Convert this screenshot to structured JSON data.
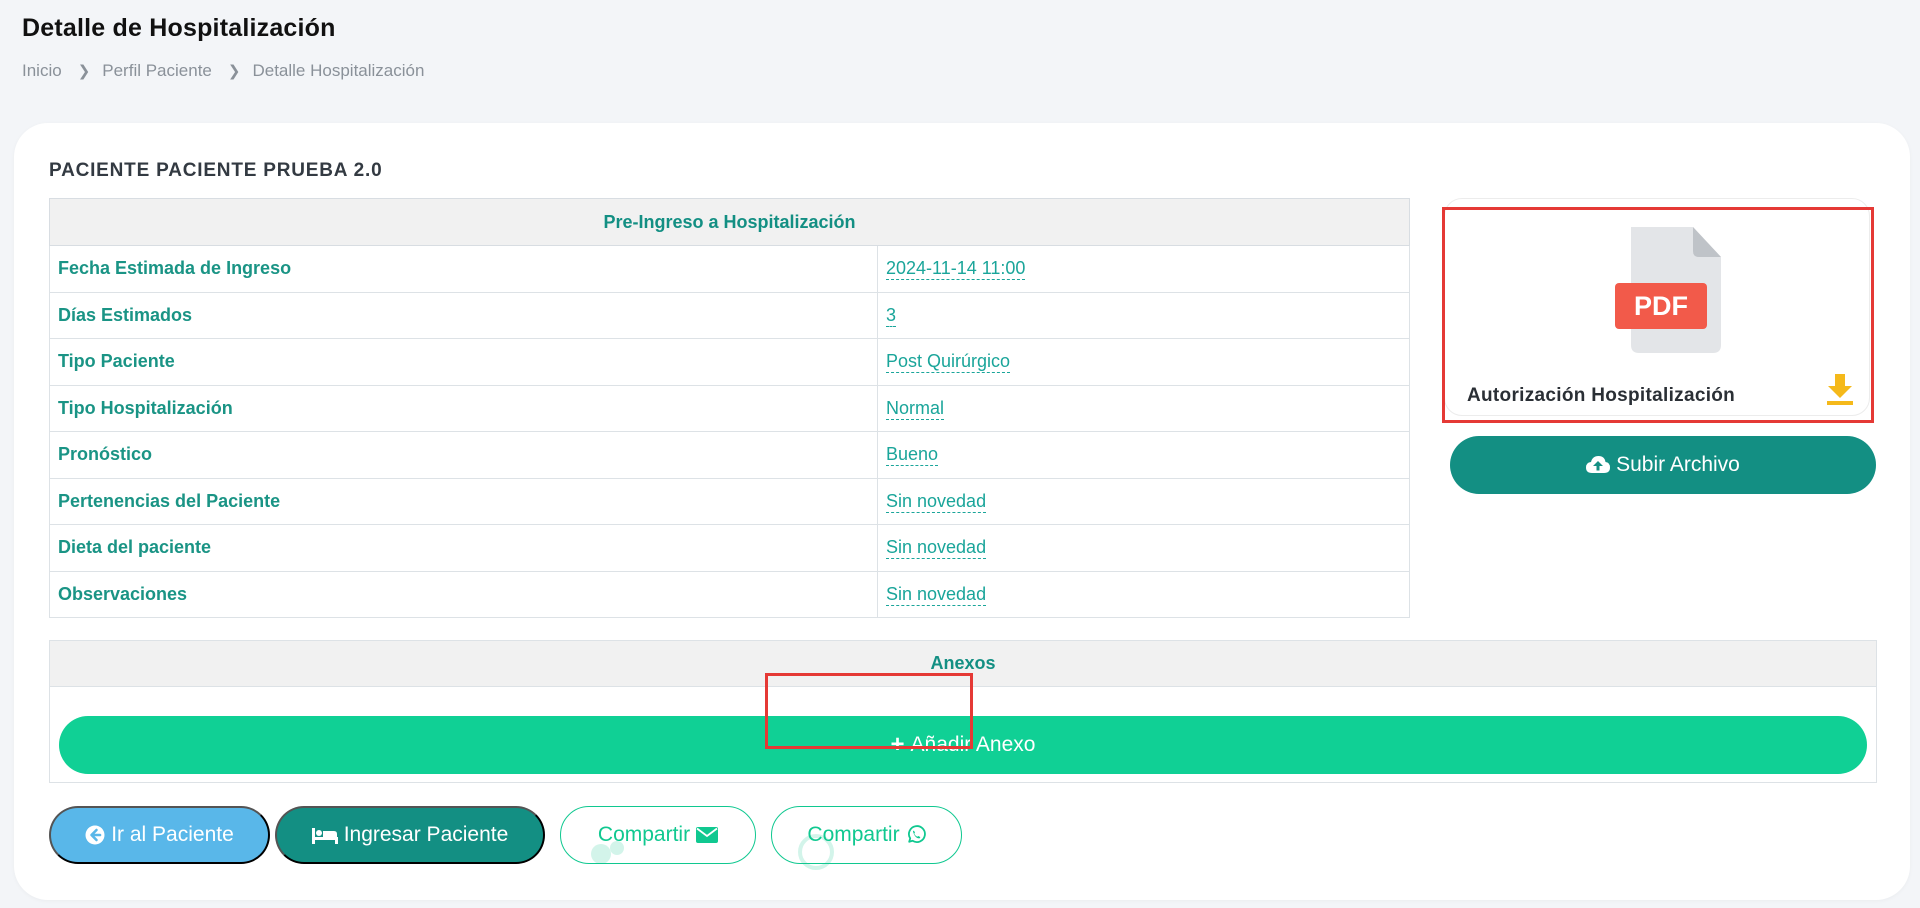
{
  "page": {
    "title": "Detalle de Hospitalización",
    "breadcrumb": [
      "Inicio",
      "Perfil Paciente",
      "Detalle Hospitalización"
    ]
  },
  "patient": {
    "name": "PACIENTE PACIENTE PRUEBA 2.0"
  },
  "pre_admission": {
    "header": "Pre-Ingreso a Hospitalización",
    "rows": [
      {
        "label": "Fecha Estimada de Ingreso",
        "value": "2024-11-14 11:00"
      },
      {
        "label": "Días Estimados",
        "value": "3"
      },
      {
        "label": "Tipo Paciente",
        "value": "Post Quirúrgico"
      },
      {
        "label": "Tipo Hospitalización",
        "value": "Normal"
      },
      {
        "label": "Pronóstico",
        "value": "Bueno"
      },
      {
        "label": "Pertenencias del Paciente",
        "value": "Sin novedad"
      },
      {
        "label": "Dieta del paciente",
        "value": "Sin novedad"
      },
      {
        "label": "Observaciones",
        "value": "Sin novedad"
      }
    ]
  },
  "file": {
    "icon": "pdf-file-icon",
    "icon_label": "PDF",
    "name": "Autorización Hospitalización",
    "download_icon": "download-icon",
    "upload_label": "Subir Archivo",
    "upload_icon": "cloud-upload-icon"
  },
  "annexes": {
    "header": "Anexos",
    "add_label": "Añadir Anexo"
  },
  "actions": {
    "go_patient": "Ir al Paciente",
    "admit_patient": "Ingresar Paciente",
    "share_email": "Compartir",
    "share_whatsapp": "Compartir"
  },
  "colors": {
    "primary_teal": "#138f83",
    "accent_green": "#10d095",
    "info_blue": "#59b7e9",
    "highlight_red": "#e53935",
    "pdf_red": "#f25a4a",
    "download_yellow": "#f5b91a"
  }
}
